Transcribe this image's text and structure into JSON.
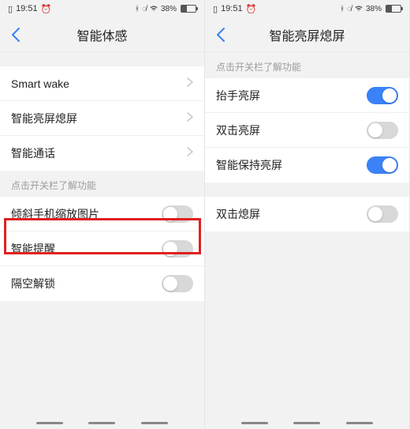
{
  "status": {
    "time": "19:51",
    "battery_pct": "38%"
  },
  "left": {
    "title": "智能体感",
    "group1": [
      {
        "label": "Smart wake",
        "type": "link"
      },
      {
        "label": "智能亮屏熄屏",
        "type": "link"
      },
      {
        "label": "智能通话",
        "type": "link"
      }
    ],
    "hint": "点击开关栏了解功能",
    "group2": [
      {
        "label": "倾斜手机缩放图片",
        "type": "toggle",
        "on": false
      },
      {
        "label": "智能提醒",
        "type": "toggle",
        "on": false
      },
      {
        "label": "隔空解锁",
        "type": "toggle",
        "on": false,
        "highlighted": true
      }
    ]
  },
  "right": {
    "title": "智能亮屏熄屏",
    "hint": "点击开关栏了解功能",
    "group1": [
      {
        "label": "抬手亮屏",
        "type": "toggle",
        "on": true
      },
      {
        "label": "双击亮屏",
        "type": "toggle",
        "on": false
      },
      {
        "label": "智能保持亮屏",
        "type": "toggle",
        "on": true
      }
    ],
    "group2": [
      {
        "label": "双击熄屏",
        "type": "toggle",
        "on": false
      }
    ]
  }
}
